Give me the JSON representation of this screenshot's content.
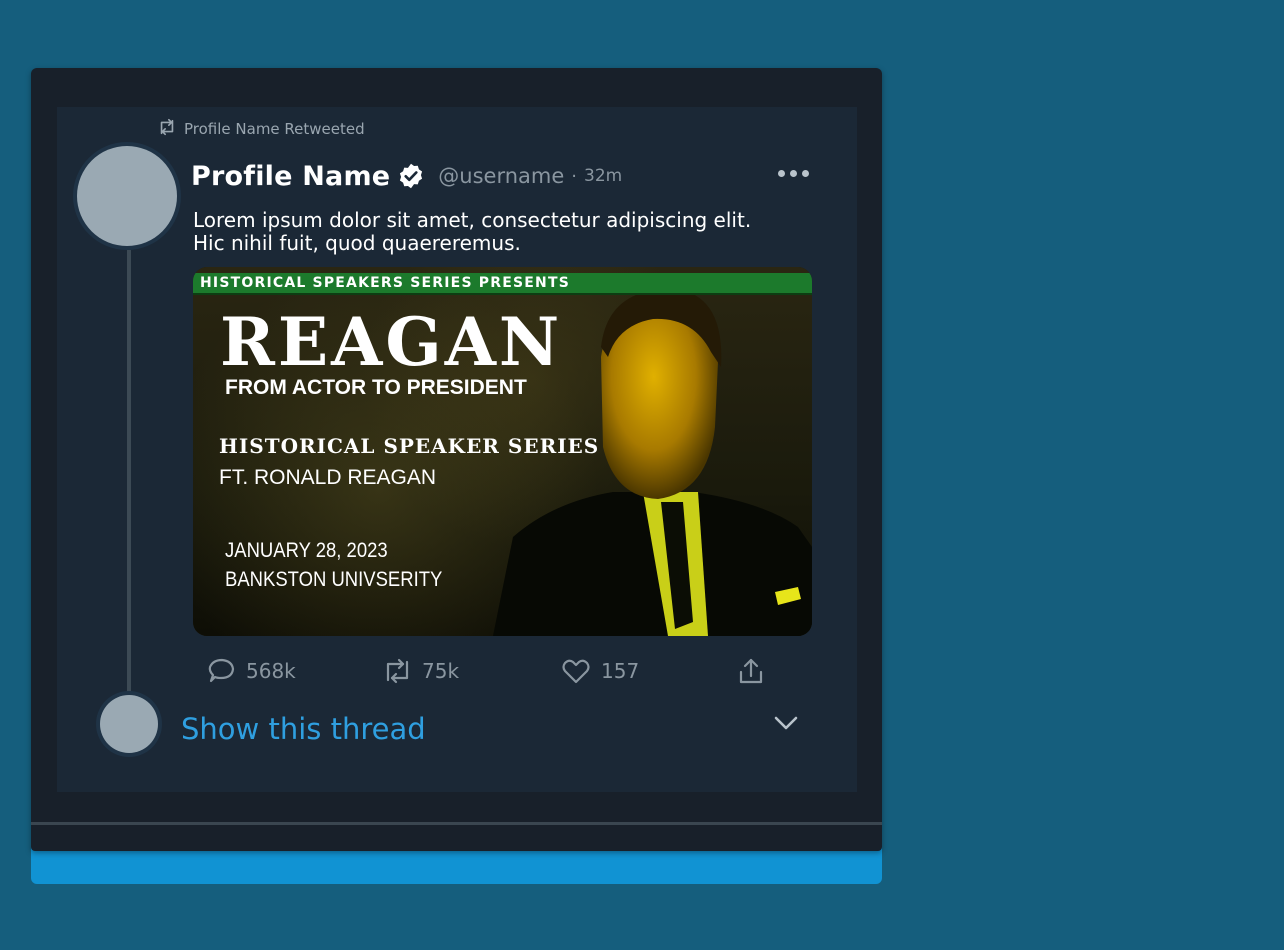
{
  "retweet": {
    "label": "Profile Name Retweeted"
  },
  "tweet": {
    "profile_name": "Profile Name",
    "username": "@username",
    "separator": "·",
    "time_ago": "32m",
    "text_lines": [
      "Lorem ipsum dolor sit amet, consectetur adipiscing elit.",
      "Hic nihil fuit, quod quaereremus."
    ]
  },
  "media": {
    "banner": "HISTORICAL SPEAKERS SERIES PRESENTS",
    "title": "REAGAN",
    "subtitle": "FROM ACTOR TO PRESIDENT",
    "series": "HISTORICAL SPEAKER SERIES",
    "featuring": "FT. RONALD REAGAN",
    "date": "JANUARY 28, 2023",
    "venue": "BANKSTON UNIVSERITY"
  },
  "actions": {
    "replies": "568k",
    "retweets": "75k",
    "likes": "157"
  },
  "thread": {
    "label": "Show this thread"
  },
  "colors": {
    "background": "#155e7d",
    "card": "#18202a",
    "panel": "#1b2836",
    "accent": "#2f9fe0",
    "bottom_bar": "#1193d3",
    "banner_green": "#1c7a2c"
  },
  "icons": [
    "retweet-icon",
    "verified-icon",
    "more-icon",
    "reply-icon",
    "like-icon",
    "share-icon",
    "chevron-down-icon"
  ]
}
